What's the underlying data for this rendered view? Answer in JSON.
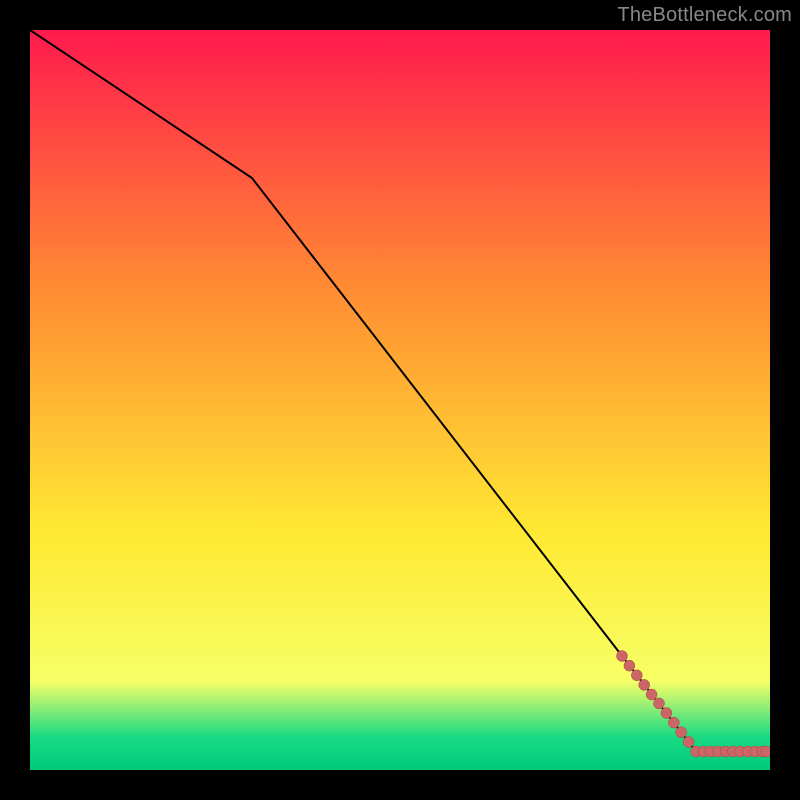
{
  "watermark": "TheBottleneck.com",
  "colors": {
    "frame_bg": "#000000",
    "line": "#000000",
    "marker_fill": "#cc6666",
    "marker_stroke": "#aa4444",
    "gradient_top": "#ff1a4d",
    "gradient_mid_upper": "#ff8c33",
    "gradient_mid": "#ffe933",
    "gradient_mid_lower": "#f7ff66",
    "gradient_green": "#1adb84",
    "gradient_bottom": "#00c97a"
  },
  "chart_data": {
    "type": "line",
    "title": "",
    "xlabel": "",
    "ylabel": "",
    "xlim": [
      0,
      100
    ],
    "ylim": [
      0,
      100
    ],
    "axes_visible": false,
    "series": [
      {
        "name": "curve",
        "x": [
          0,
          30,
          90,
          100
        ],
        "values": [
          100,
          80,
          2.5,
          2.5
        ]
      }
    ],
    "markers": {
      "name": "highlight-points",
      "x": [
        80,
        81,
        82,
        83,
        84,
        85,
        86,
        87,
        88,
        89,
        90,
        91,
        92,
        93,
        94,
        95,
        96,
        97,
        98,
        99,
        99.5
      ],
      "values": [
        15.4,
        14.1,
        12.8,
        11.5,
        10.2,
        9.0,
        7.7,
        6.4,
        5.1,
        3.8,
        2.5,
        2.5,
        2.5,
        2.5,
        2.5,
        2.5,
        2.5,
        2.5,
        2.5,
        2.5,
        2.5
      ]
    },
    "background_gradient_stops": [
      {
        "offset": 0.0,
        "color_key": "gradient_top"
      },
      {
        "offset": 0.35,
        "color_key": "gradient_mid_upper"
      },
      {
        "offset": 0.68,
        "color_key": "gradient_mid"
      },
      {
        "offset": 0.88,
        "color_key": "gradient_mid_lower"
      },
      {
        "offset": 0.955,
        "color_key": "gradient_green"
      },
      {
        "offset": 1.0,
        "color_key": "gradient_bottom"
      }
    ]
  }
}
